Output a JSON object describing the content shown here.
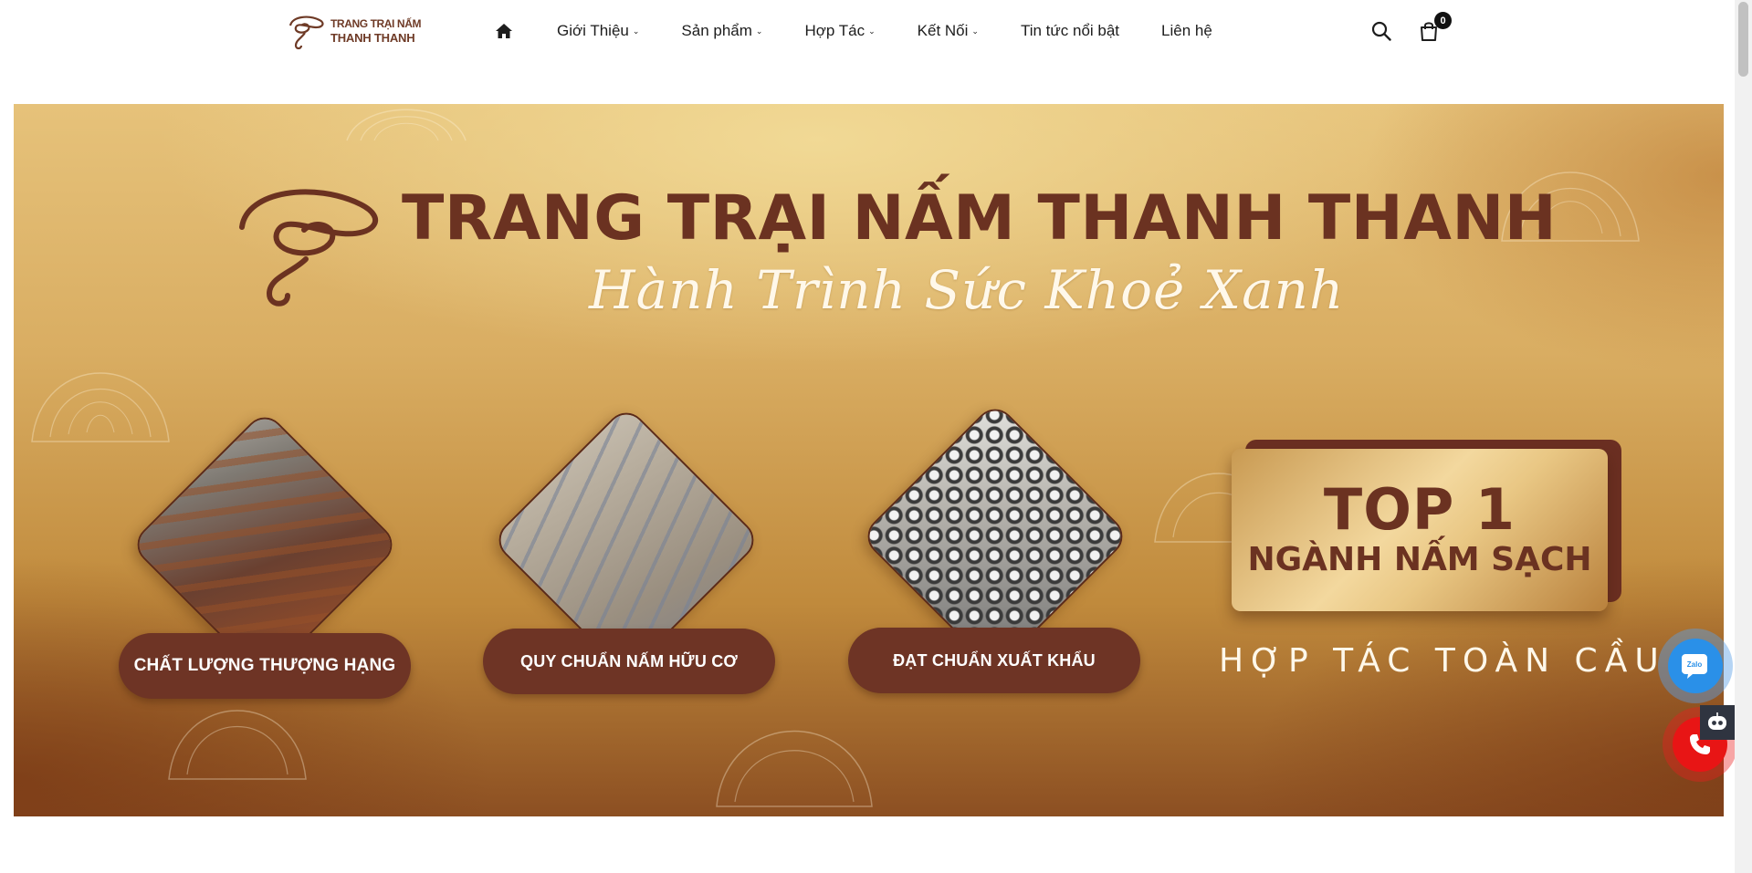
{
  "header": {
    "logo": {
      "line1": "TRANG TRẠI NẤM",
      "line2": "THANH THANH"
    },
    "nav": {
      "home_icon": "home-icon",
      "items": [
        {
          "label": "Giới Thiệu",
          "has_dropdown": true
        },
        {
          "label": "Sản phẩm",
          "has_dropdown": true
        },
        {
          "label": "Hợp Tác",
          "has_dropdown": true
        },
        {
          "label": "Kết Nối",
          "has_dropdown": true
        },
        {
          "label": "Tin tức nổi bật",
          "has_dropdown": false
        },
        {
          "label": "Liên hệ",
          "has_dropdown": false
        }
      ]
    },
    "icons": {
      "search": "search-icon",
      "cart": "shopping-bag-icon"
    },
    "cart_count": "0"
  },
  "banner": {
    "title": "TRANG TRẠI NẤM THANH THANH",
    "tagline": "Hành Trình Sức Khoẻ Xanh",
    "pills": [
      "CHẤT LƯỢNG THƯỢNG HẠNG",
      "QUY CHUẨN NẤM HỮU CƠ",
      "ĐẠT CHUẨN XUẤT KHẨU"
    ],
    "top_card": {
      "line1": "TOP 1",
      "line2": "NGÀNH NẤM SẠCH"
    },
    "cooperate": "HỢP TÁC TOÀN CẦU"
  },
  "floating": {
    "zalo_label": "Zalo",
    "zalo_icon": "zalo-icon",
    "phone_icon": "phone-icon",
    "bot_icon": "chatbot-icon"
  },
  "colors": {
    "brand_brown": "#6e3425",
    "banner_gold": "#e6c27a",
    "zalo_blue": "#2a90e8",
    "phone_red": "#e81515"
  }
}
